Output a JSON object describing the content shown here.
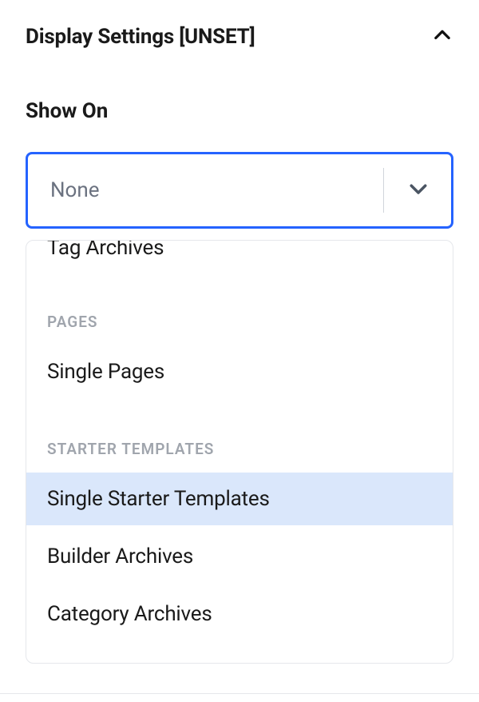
{
  "section": {
    "title": "Display Settings [UNSET]"
  },
  "field": {
    "label": "Show On",
    "placeholder": "None"
  },
  "dropdown": {
    "partial_item": "Tag Archives",
    "group_pages": {
      "label": "PAGES",
      "items": [
        {
          "label": "Single Pages",
          "highlight": false
        }
      ]
    },
    "group_starter": {
      "label": "STARTER TEMPLATES",
      "items": [
        {
          "label": "Single Starter Templates",
          "highlight": true
        },
        {
          "label": "Builder Archives",
          "highlight": false
        },
        {
          "label": "Category Archives",
          "highlight": false
        }
      ]
    }
  }
}
